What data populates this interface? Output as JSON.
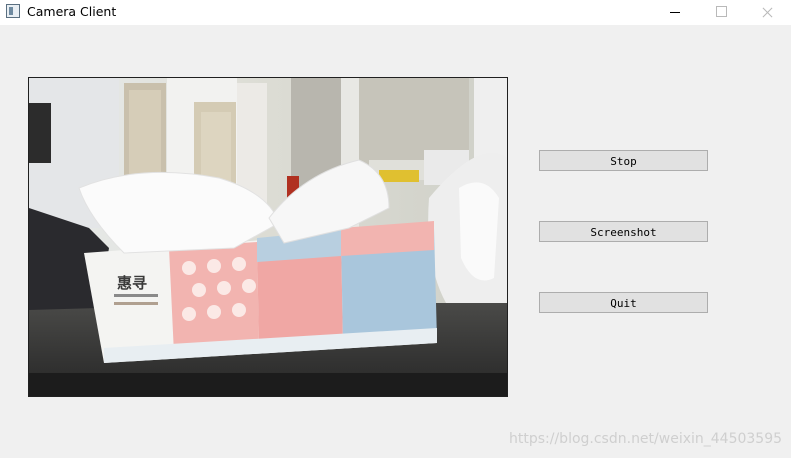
{
  "window": {
    "title": "Camera Client"
  },
  "camera_feed": {
    "box_brand": "惠寻"
  },
  "buttons": {
    "stop": "Stop",
    "screenshot": "Screenshot",
    "quit": "Quit"
  },
  "watermark": "https://blog.csdn.net/weixin_44503595",
  "colors": {
    "window_background": "#f0f0f0",
    "button_face": "#e1e1e1",
    "button_border": "#adadad"
  },
  "icons": [
    "app-icon",
    "minimize-icon",
    "maximize-icon",
    "close-icon"
  ]
}
